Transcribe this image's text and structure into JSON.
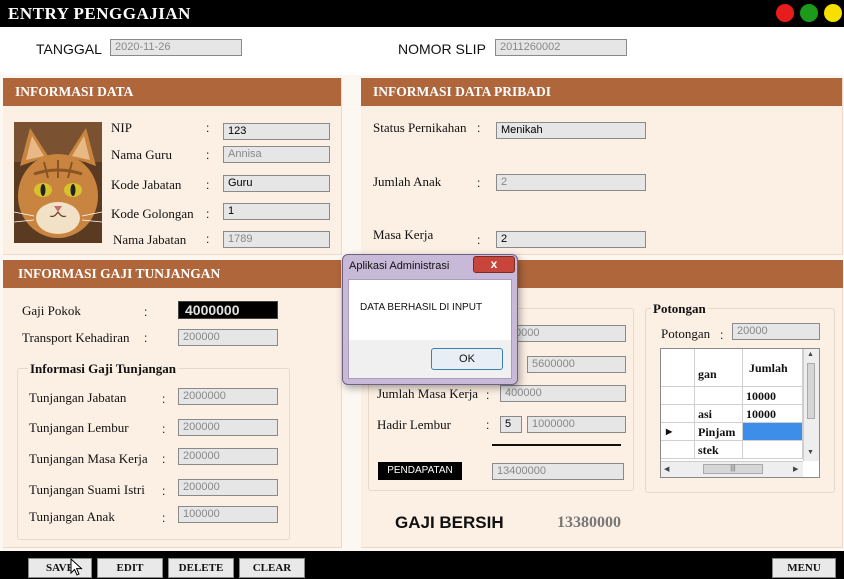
{
  "app": {
    "title": "ENTRY PENGGAJIAN"
  },
  "window_controls": {
    "red": "#e81c1c",
    "green": "#1b9a1b",
    "yellow": "#f5e000"
  },
  "header": {
    "tanggal_label": "TANGGAL",
    "tanggal_value": "2020-11-26",
    "nomor_slip_label": "NOMOR SLIP",
    "nomor_slip_value": "2011260002"
  },
  "informasi_data": {
    "title": "INFORMASI DATA",
    "nip_label": "NIP",
    "nip_value": "123",
    "nama_guru_label": "Nama Guru",
    "nama_guru_value": "Annisa",
    "kode_jabatan_label": "Kode Jabatan",
    "kode_jabatan_value": "Guru",
    "kode_golongan_label": "Kode Golongan",
    "kode_golongan_value": "1",
    "nama_jabatan_label": "Nama Jabatan",
    "nama_jabatan_value": "1789"
  },
  "informasi_pribadi": {
    "title": "INFORMASI DATA  PRIBADI",
    "status_label": "Status Pernikahan",
    "status_value": "Menikah",
    "jumlah_anak_label": "Jumlah Anak",
    "jumlah_anak_value": "2",
    "masa_kerja_label": "Masa Kerja",
    "masa_kerja_value": "2"
  },
  "gaji_tunjangan": {
    "title": "INFORMASI GAJI TUNJANGAN",
    "gaji_pokok_label": "Gaji Pokok",
    "gaji_pokok_value": "4000000",
    "transport_label": "Transport Kehadiran",
    "transport_value": "200000",
    "sub_title": "Informasi Gaji Tunjangan",
    "jabatan_label": "Tunjangan Jabatan",
    "jabatan_value": "2000000",
    "lembur_label": "Tunjangan Lembur",
    "lembur_value": "200000",
    "masa_kerja_label": "Tunjangan Masa Kerja",
    "masa_kerja_value": "200000",
    "suami_istri_label": "Tunjangan Suami Istri",
    "suami_istri_value": "200000",
    "anak_label": "Tunjangan Anak",
    "anak_value": "100000"
  },
  "middle": {
    "field1_value": "0000",
    "field2_value": "5600000",
    "jumlah_masa_kerja_label": "Jumlah Masa Kerja",
    "jumlah_masa_kerja_value": "400000",
    "hadir_lembur_label": "Hadir Lembur",
    "hadir_lembur_count": "5",
    "hadir_lembur_value": "1000000",
    "pendapatan_label": "PENDAPATAN",
    "pendapatan_value": "13400000",
    "gaji_bersih_label": "GAJI BERSIH",
    "gaji_bersih_value": "13380000"
  },
  "potongan": {
    "group_title": "Potongan",
    "label": "Potongan",
    "value": "20000",
    "table": {
      "header_col1": "gan",
      "header_col2": "Jumlah",
      "rows": [
        {
          "name": "",
          "jumlah": "10000"
        },
        {
          "name": "asi",
          "jumlah": "10000"
        },
        {
          "name": "Pinjam",
          "jumlah": ""
        },
        {
          "name": "stek",
          "jumlah": ""
        }
      ],
      "scroll_mark": "|||"
    }
  },
  "dialog": {
    "title": "Aplikasi Administrasi",
    "close": "x",
    "message": "DATA BERHASIL DI INPUT",
    "ok": "OK"
  },
  "buttons": {
    "save": "SAVE",
    "edit": "EDIT",
    "delete": "DELETE",
    "clear": "CLEAR",
    "menu": "MENU"
  },
  "colors": {
    "panel_header": "#b0663b",
    "panel_bg": "#fcefe4",
    "selection": "#3d8ee8"
  }
}
